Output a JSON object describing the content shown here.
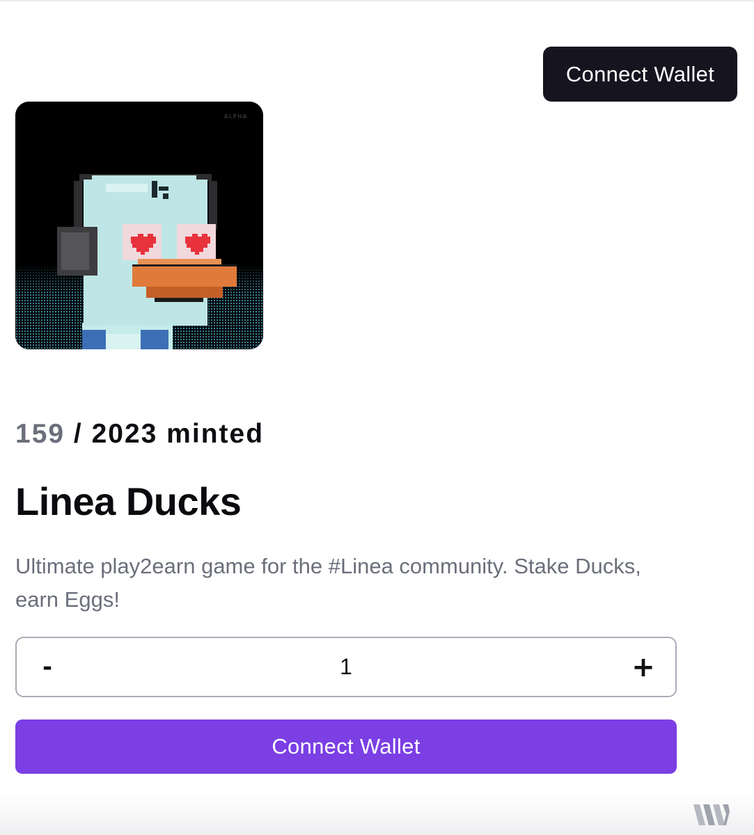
{
  "header": {
    "connect_label": "Connect Wallet"
  },
  "nft": {
    "image_label": "ALPHA"
  },
  "collection": {
    "minted_count": "159",
    "minted_rest": " / 2023 minted",
    "title": "Linea Ducks",
    "description": "Ultimate play2earn game for the #Linea community. Stake Ducks, earn Eggs!"
  },
  "stepper": {
    "minus_label": "-",
    "quantity": "1",
    "plus_label": "+"
  },
  "mint": {
    "button_label": "Connect Wallet"
  },
  "colors": {
    "header_button_bg": "#16141f",
    "primary_purple": "#7b3fe4",
    "muted_text": "#6b6f7b"
  },
  "icons": {
    "brand": "w-logo-icon"
  }
}
